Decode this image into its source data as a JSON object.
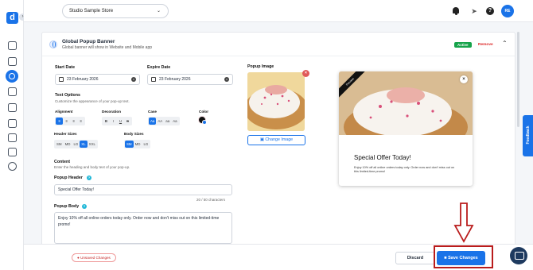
{
  "sidebar": {
    "logo": "d",
    "collapse_icon": "›",
    "items": [
      "store-icon",
      "orders-icon",
      "marketing-icon",
      "reports-icon",
      "messages-icon",
      "media-icon",
      "customers-icon",
      "integrations-icon",
      "settings-icon"
    ],
    "active": "marketing-icon"
  },
  "topbar": {
    "store_select": "Studio Sample Store",
    "help": "?",
    "avatar": "RE"
  },
  "card": {
    "title": "Global Popup Banner",
    "subtitle": "Global banner will show in Website and Mobile app",
    "status": "Active",
    "remove": "Remove"
  },
  "dates": {
    "start_label": "Start Date",
    "start_value": "23 February 2026",
    "expire_label": "Expire Date",
    "expire_value": "23 February 2026"
  },
  "text_options": {
    "title": "Text Options",
    "subtitle": "Customize the appearance of your pop-up text.",
    "alignment_label": "Alignment",
    "decoration_label": "Decoration",
    "case_label": "Case",
    "color_label": "Color",
    "decoration_buttons": [
      "B",
      "I",
      "U",
      "S"
    ],
    "case_buttons": [
      "Aa",
      "AA",
      "aa",
      "Aa"
    ],
    "header_sizes_label": "Header Sizes",
    "header_sizes": [
      "SM",
      "MD",
      "LG",
      "XL",
      "XXL"
    ],
    "header_selected": "XL",
    "body_sizes_label": "Body Sizes",
    "body_sizes": [
      "SM",
      "MD",
      "LG"
    ],
    "body_selected": "SM",
    "text_color": "#111111"
  },
  "content": {
    "title": "Content",
    "subtitle": "Enter the heading and body text of your pop-up.",
    "header_label": "Popup Header",
    "header_value": "Special Offer Today!",
    "char_count": "20 / 50 characters",
    "body_label": "Popup Body",
    "body_value": "Enjoy 10% off all online orders today only. Order now and don't miss out on this limited-time promo!"
  },
  "popup_image": {
    "label": "Popup Image",
    "change_button": "Change Image",
    "delete_icon": "×"
  },
  "preview": {
    "ribbon": "Preview",
    "close": "×",
    "heading": "Special Offer Today!",
    "body": "Enjoy 10% off all online orders today only. Order now and don't miss out on this limited-time promo!"
  },
  "bottom": {
    "unsaved": "Unsaved Changes",
    "discard": "Discard",
    "save": "Save Changes"
  },
  "feedback": "Feedback",
  "colors": {
    "primary": "#1a73e8",
    "active_badge": "#16a34a",
    "remove": "#dc2626",
    "highlight": "#b91c1c"
  }
}
